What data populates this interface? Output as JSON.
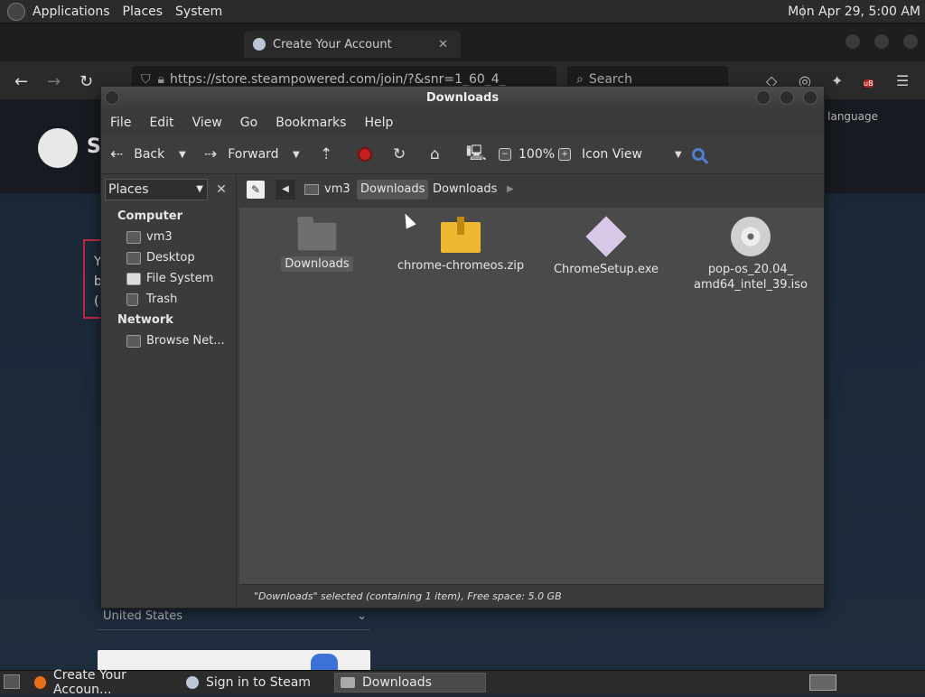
{
  "top_panel": {
    "menus": [
      "Applications",
      "Places",
      "System"
    ],
    "clock": "Mon Apr 29,  5:00 AM"
  },
  "browser": {
    "tab_active": {
      "title": "Create Your Account",
      "close": "✕"
    },
    "url": "https://store.steampowered.com/join/?&snr=1_60_4_",
    "search_placeholder": "Search",
    "steam_initial": "S",
    "language_label": "language",
    "red_box_lines": [
      "Y",
      "b",
      "("
    ],
    "country_value": "United States"
  },
  "file_manager": {
    "title": "Downloads",
    "menu": [
      "File",
      "Edit",
      "View",
      "Go",
      "Bookmarks",
      "Help"
    ],
    "toolbar": {
      "back": "Back",
      "forward": "Forward",
      "zoom": "100%",
      "view_mode": "Icon View"
    },
    "sidebar": {
      "header": "Places",
      "sections": [
        {
          "title": "Computer",
          "items": [
            "vm3",
            "Desktop",
            "File System",
            "Trash"
          ]
        },
        {
          "title": "Network",
          "items": [
            "Browse Net..."
          ]
        }
      ]
    },
    "breadcrumb": [
      "vm3",
      "Downloads",
      "Downloads"
    ],
    "files": [
      {
        "name": "Downloads",
        "type": "folder",
        "selected": true
      },
      {
        "name": "chrome-chromeos.zip",
        "type": "zip"
      },
      {
        "name": "ChromeSetup.exe",
        "type": "exe"
      },
      {
        "name_line1": "pop-os_20.04_",
        "name_line2": "amd64_intel_39.iso",
        "type": "iso"
      }
    ],
    "status": "\"Downloads\" selected (containing 1 item), Free space: 5.0 GB"
  },
  "taskbar": {
    "tasks": [
      "Create Your Accoun...",
      "Sign in to Steam",
      "Downloads"
    ]
  }
}
